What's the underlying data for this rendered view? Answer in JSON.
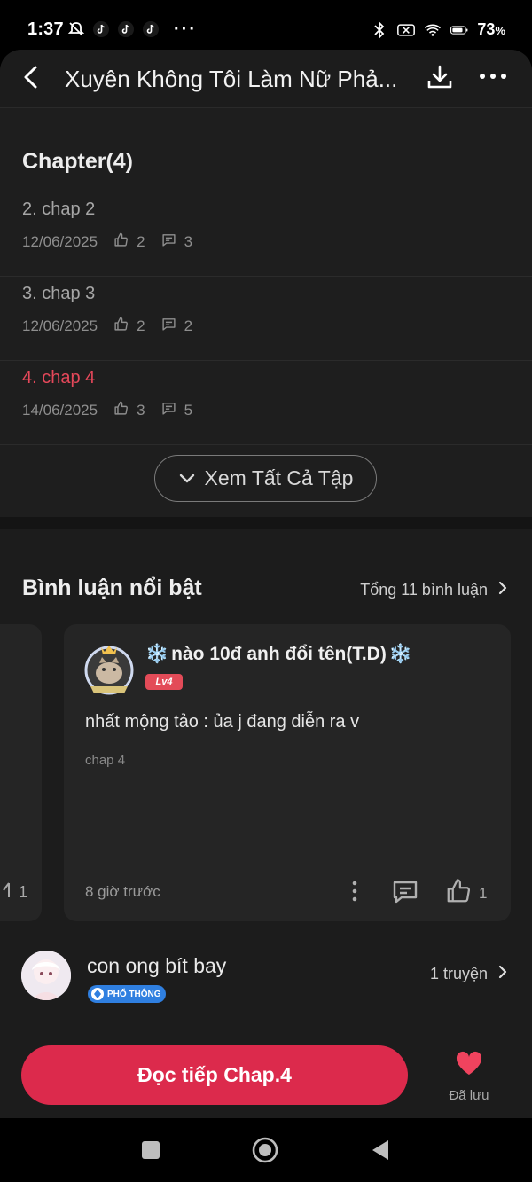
{
  "status_bar": {
    "time": "1:37",
    "battery": "73"
  },
  "header": {
    "title": "Xuyên Không Tôi Làm Nữ Phả..."
  },
  "chapters": {
    "heading": "Chapter(4)",
    "items": [
      {
        "title": "2. chap 2",
        "date": "12/06/2025",
        "likes": "2",
        "comments": "3",
        "active": false
      },
      {
        "title": "3. chap 3",
        "date": "12/06/2025",
        "likes": "2",
        "comments": "2",
        "active": false
      },
      {
        "title": "4. chap 4",
        "date": "14/06/2025",
        "likes": "3",
        "comments": "5",
        "active": true
      }
    ],
    "view_all_label": "Xem Tất Cả Tập"
  },
  "comments": {
    "title": "Bình luận nổi bật",
    "total_label": "Tổng 11 bình luận",
    "prev_card_likes": "1",
    "featured": {
      "username": "nào 10đ anh đổi tên(T.D)",
      "level": "Lv4",
      "text": "nhất mộng tảo : ủa j đang diễn ra v",
      "chapter": "chap 4",
      "time": "8 giờ trước",
      "likes": "1"
    }
  },
  "author": {
    "name": "con ong bít bay",
    "badge": "PHỔ THÔNG",
    "stories": "1 truyện"
  },
  "bottom": {
    "read_label": "Đọc tiếp Chap.4",
    "saved_label": "Đã lưu"
  },
  "colors": {
    "accent": "#dc2a4c",
    "active_chapter": "#e5485a",
    "background": "#1c1c1c"
  }
}
